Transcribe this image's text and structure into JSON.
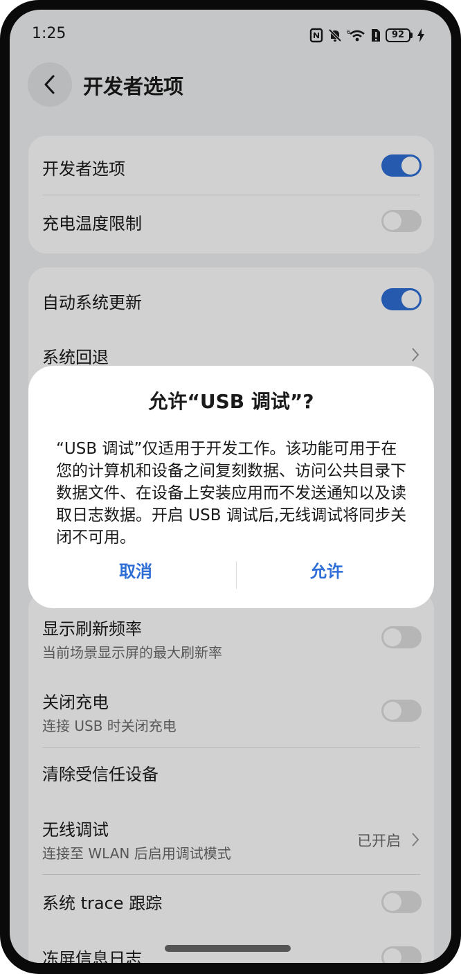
{
  "status_bar": {
    "time": "1:25",
    "battery": "92"
  },
  "header": {
    "title": "开发者选项"
  },
  "card1": {
    "items": [
      {
        "title": "开发者选项",
        "toggle": "on"
      },
      {
        "title": "充电温度限制",
        "toggle": "off"
      }
    ]
  },
  "card2": {
    "items": [
      {
        "title": "自动系统更新",
        "toggle": "on"
      },
      {
        "title": "系统回退"
      }
    ]
  },
  "card3": {
    "items": [
      {
        "title": "显示刷新频率",
        "subtitle": "当前场景显示屏的最大刷新率",
        "toggle": "off"
      },
      {
        "title": "关闭充电",
        "subtitle": "连接 USB 时关闭充电",
        "toggle": "off"
      },
      {
        "title": "清除受信任设备"
      },
      {
        "title": "无线调试",
        "subtitle": "连接至 WLAN 后启用调试模式",
        "value": "已开启"
      },
      {
        "title": "系统 trace 跟踪",
        "toggle": "off"
      },
      {
        "title": "冻屏信息日志",
        "toggle": "off"
      }
    ]
  },
  "dialog": {
    "title": "允许“USB 调试”?",
    "message": "“USB 调试”仅适用于开发工作。该功能可用于在您的计算机和设备之间复刻数据、访问公共目录下数据文件、在设备上安装应用而不发送通知以及读取日志数据。开启 USB 调试后,无线调试将同步关闭不可用。",
    "cancel_label": "取消",
    "confirm_label": "允许"
  },
  "colors": {
    "accent": "#2e6ed6",
    "background": "#f1f2f4",
    "card": "#ffffff"
  }
}
